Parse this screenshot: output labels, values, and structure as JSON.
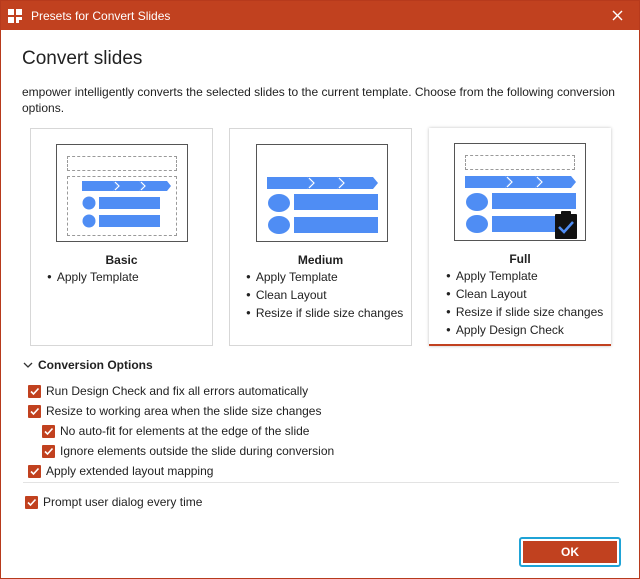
{
  "window": {
    "title": "Presets for Convert Slides",
    "accent_color": "#c1411f",
    "focus_color": "#1fa3d6"
  },
  "heading": "Convert slides",
  "description": "empower intelligently converts the selected slides to the current template. Choose from the following conversion options.",
  "presets": [
    {
      "name": "Basic",
      "features": [
        "Apply Template"
      ],
      "selected": false
    },
    {
      "name": "Medium",
      "features": [
        "Apply Template",
        "Clean Layout",
        "Resize if slide size changes"
      ],
      "selected": false
    },
    {
      "name": "Full",
      "features": [
        "Apply Template",
        "Clean Layout",
        "Resize if slide size changes",
        "Apply Design Check"
      ],
      "selected": true
    }
  ],
  "conversion_options": {
    "header": "Conversion Options",
    "expanded": true,
    "items": [
      {
        "label": "Run Design Check and fix all errors automatically",
        "checked": true
      },
      {
        "label": "Resize to working area when the slide size changes",
        "checked": true
      },
      {
        "label": "No auto-fit for elements at the edge of the slide",
        "checked": true
      },
      {
        "label": "Ignore elements outside the slide during conversion",
        "checked": true
      },
      {
        "label": "Apply extended layout mapping",
        "checked": true
      }
    ]
  },
  "prompt_option": {
    "label": "Prompt user dialog every time",
    "checked": true
  },
  "ok_label": "OK",
  "icons": {
    "app": "empower-app-icon",
    "close": "close-icon",
    "clipboard_check": "clipboard-check-icon",
    "chevron": "chevron-down-icon",
    "checkbox": "checkmark-icon"
  }
}
